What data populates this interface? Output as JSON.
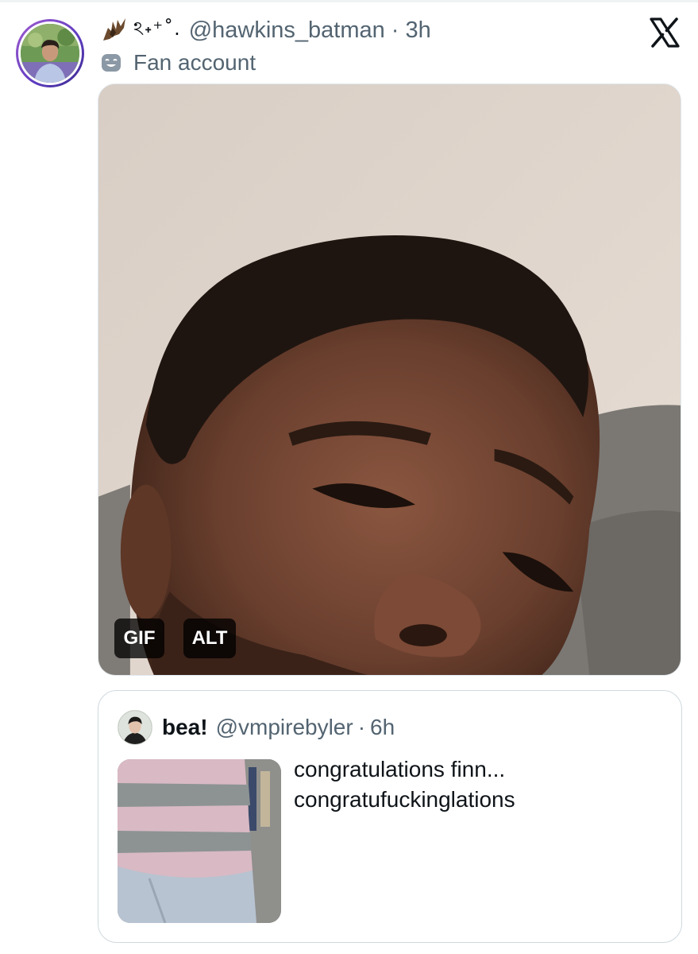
{
  "post": {
    "avatar_icon": "user-avatar-photo",
    "decoration_symbols": "ঽ˖⁺˚.",
    "handle": "@hawkins_batman",
    "separator": "·",
    "time": "3h",
    "label": "Fan account",
    "label_icon": "theater-mask-icon",
    "brand_icon": "x-logo-icon"
  },
  "media": {
    "badge_gif": "GIF",
    "badge_alt": "ALT"
  },
  "quote": {
    "name": "bea!",
    "handle": "@vmpirebyler",
    "separator": "·",
    "time": "6h",
    "text_line_1": "congratulations finn...",
    "text_line_2": "congratufuckinglations"
  },
  "colors": {
    "text": "#0f1419",
    "secondary": "#536471",
    "border": "#cfd9de",
    "badge_bg": "#000000c4"
  }
}
